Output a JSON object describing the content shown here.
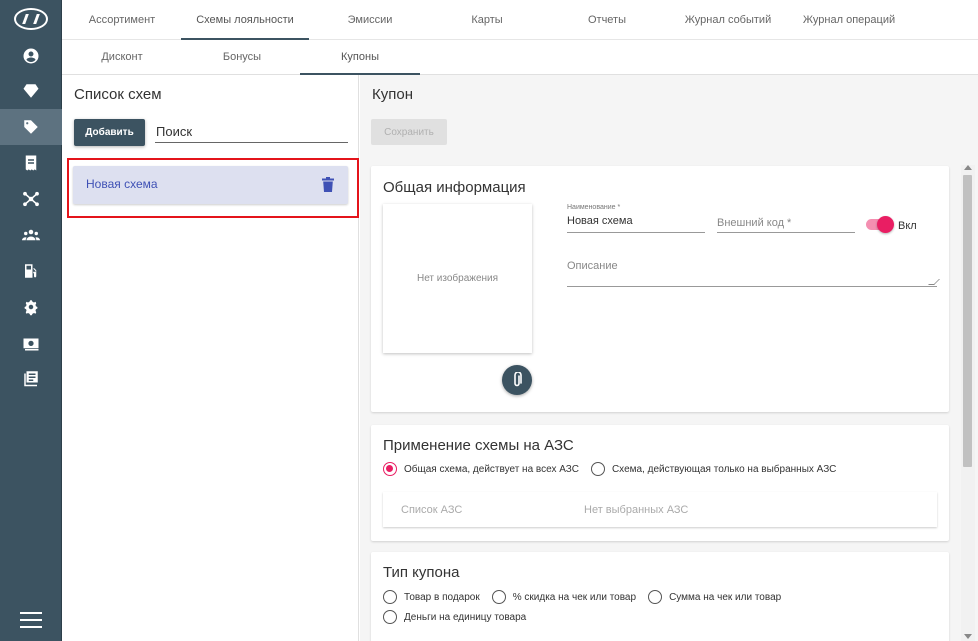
{
  "nav_tabs": [
    {
      "label": "Ассортимент"
    },
    {
      "label": "Схемы лояльности"
    },
    {
      "label": "Эмиссии"
    },
    {
      "label": "Карты"
    },
    {
      "label": "Отчеты"
    },
    {
      "label": "Журнал событий"
    },
    {
      "label": "Журнал операций"
    }
  ],
  "sub_tabs": [
    {
      "label": "Дисконт"
    },
    {
      "label": "Бонусы"
    },
    {
      "label": "Купоны"
    }
  ],
  "sidebar_icons": [
    "user-icon",
    "diamond-icon",
    "tag-icon",
    "receipt-icon",
    "network-icon",
    "group-icon",
    "fuel-icon",
    "settings-icon",
    "money-icon",
    "list-icon"
  ],
  "left_panel": {
    "title": "Список схем",
    "add_label": "Добавить",
    "search_placeholder": "Поиск",
    "items": [
      {
        "name": "Новая схема"
      }
    ]
  },
  "main": {
    "title": "Купон",
    "save_label": "Сохранить",
    "general": {
      "title": "Общая информация",
      "no_image": "Нет изображения",
      "name_label": "Наименование *",
      "name_value": "Новая схема",
      "ext_code_placeholder": "Внешний код *",
      "toggle_label": "Вкл",
      "description_placeholder": "Описание"
    },
    "azs": {
      "title": "Применение схемы на АЗС",
      "option_all": "Общая схема, действует на всех АЗС",
      "option_selected": "Схема, действующая только на выбранных АЗС",
      "list_label": "Список АЗС",
      "list_empty": "Нет выбранных АЗС"
    },
    "coupon_type": {
      "title": "Тип купона",
      "options": [
        {
          "label": "Товар в подарок"
        },
        {
          "label": "% скидка на чек или товар"
        },
        {
          "label": "Сумма на чек или товар"
        },
        {
          "label": "Деньги на единицу товара"
        }
      ]
    }
  },
  "colors": {
    "sidebar": "#3c5361",
    "accent": "#e91e63",
    "selected_item": "#dde0f0",
    "link_text": "#3f51b5",
    "highlight_border": "#e4141b"
  }
}
